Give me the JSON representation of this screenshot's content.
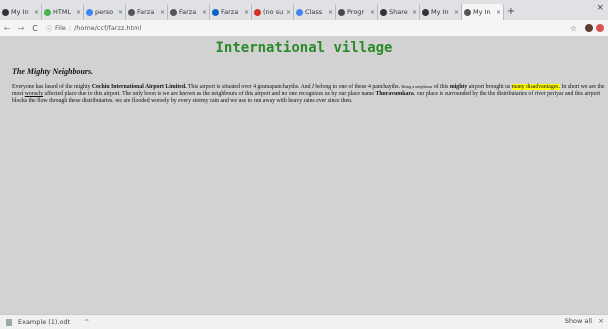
{
  "tabs": [
    {
      "icon": "github-icon",
      "title": "My In"
    },
    {
      "icon": "w3-icon",
      "title": "HTML"
    },
    {
      "icon": "google-icon",
      "title": "perso"
    },
    {
      "icon": "globe-icon",
      "title": "Farza"
    },
    {
      "icon": "globe-icon",
      "title": "Farza"
    },
    {
      "icon": "linkedin-icon",
      "title": "Farza"
    },
    {
      "icon": "gmail-icon",
      "title": "(no su"
    },
    {
      "icon": "google-icon",
      "title": "Class"
    },
    {
      "icon": "doc-icon",
      "title": "Progr"
    },
    {
      "icon": "share-icon",
      "title": "Share"
    },
    {
      "icon": "github-icon",
      "title": "My In"
    },
    {
      "icon": "globe-icon",
      "title": "My In"
    }
  ],
  "window": {
    "new_tab": "+",
    "close": "×"
  },
  "toolbar": {
    "back": "←",
    "forward": "→",
    "reload": "C",
    "info": "ⓘ",
    "scheme": "File",
    "url": "/home/ccf/farzz.html",
    "star": "☆"
  },
  "page": {
    "heading": "International village",
    "subheading": "The Mighty Neighbours.",
    "p1": "Everyone has heard of the mighty ",
    "p1b": "Cochin International Airport Limited.",
    "p2": " This airport is situated over 4 gramapanchayths. And ",
    "p2i": "I",
    "p3": " belong to one of these 4 panchayths. ",
    "p3small": "Being a neighbour",
    "p4": " of this ",
    "p4b": "mighty",
    "p5": " airport brought us ",
    "p5hl": "many disadvantages.",
    "p6": " In short we are the most ",
    "p6u": "worsely",
    "p7": " affected place due to this airport. The only boon is we are known as the neighbours of this airport and no one recognizes us by our place name ",
    "p7b": "Thuravumkara",
    "p8": ". our place is surrounded by the the distributaries of river periyar and this airport blocks the flow through these distributaries. we are flooded worsely by every stormy rain and we use to run away with heavy rains ever since then."
  },
  "downloads": {
    "file": "Example (1).odt",
    "chevron": "^",
    "show_all": "Show all",
    "close": "×"
  }
}
